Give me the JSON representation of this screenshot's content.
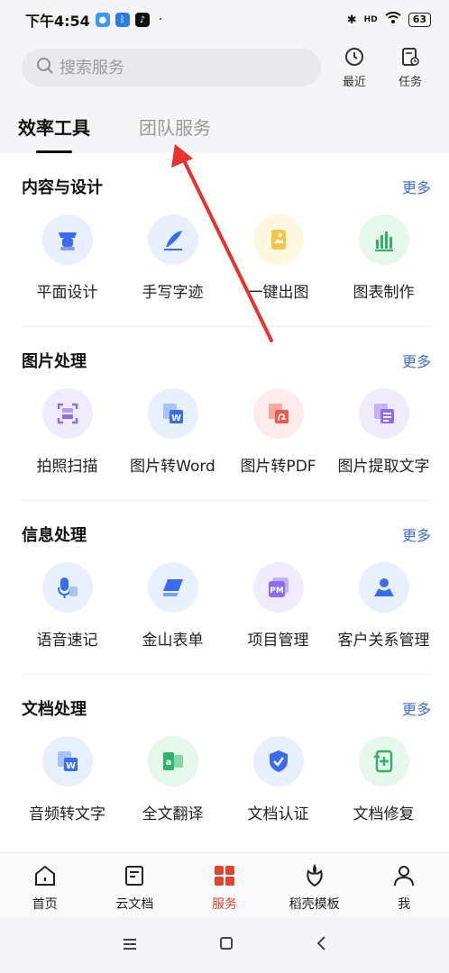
{
  "status_bar": {
    "time": "下午4:54",
    "battery": "63",
    "network": "HD"
  },
  "search": {
    "placeholder": "搜索服务"
  },
  "top_actions": [
    {
      "label": "最近"
    },
    {
      "label": "任务"
    }
  ],
  "tabs": [
    {
      "label": "效率工具",
      "active": true
    },
    {
      "label": "团队服务",
      "active": false
    }
  ],
  "sections": [
    {
      "title": "内容与设计",
      "more": "更多",
      "items": [
        {
          "label": "平面设计"
        },
        {
          "label": "手写字迹"
        },
        {
          "label": "一键出图"
        },
        {
          "label": "图表制作"
        }
      ]
    },
    {
      "title": "图片处理",
      "more": "更多",
      "items": [
        {
          "label": "拍照扫描"
        },
        {
          "label": "图片转Word"
        },
        {
          "label": "图片转PDF"
        },
        {
          "label": "图片提取文字"
        }
      ]
    },
    {
      "title": "信息处理",
      "more": "更多",
      "items": [
        {
          "label": "语音速记"
        },
        {
          "label": "金山表单"
        },
        {
          "label": "项目管理"
        },
        {
          "label": "客户关系管理"
        }
      ]
    },
    {
      "title": "文档处理",
      "more": "更多",
      "items": [
        {
          "label": "音频转文字"
        },
        {
          "label": "全文翻译"
        },
        {
          "label": "文档认证"
        },
        {
          "label": "文档修复"
        }
      ]
    }
  ],
  "bottom_nav": [
    {
      "label": "首页"
    },
    {
      "label": "云文档"
    },
    {
      "label": "服务",
      "active": true
    },
    {
      "label": "稻壳模板"
    },
    {
      "label": "我"
    }
  ],
  "icon_badges": {
    "pm": "PM",
    "a": "a",
    "w": "W"
  },
  "colors": {
    "accent_red": "#e0432f",
    "link_blue": "#3a6ee0",
    "arrow": "#e8322c"
  }
}
